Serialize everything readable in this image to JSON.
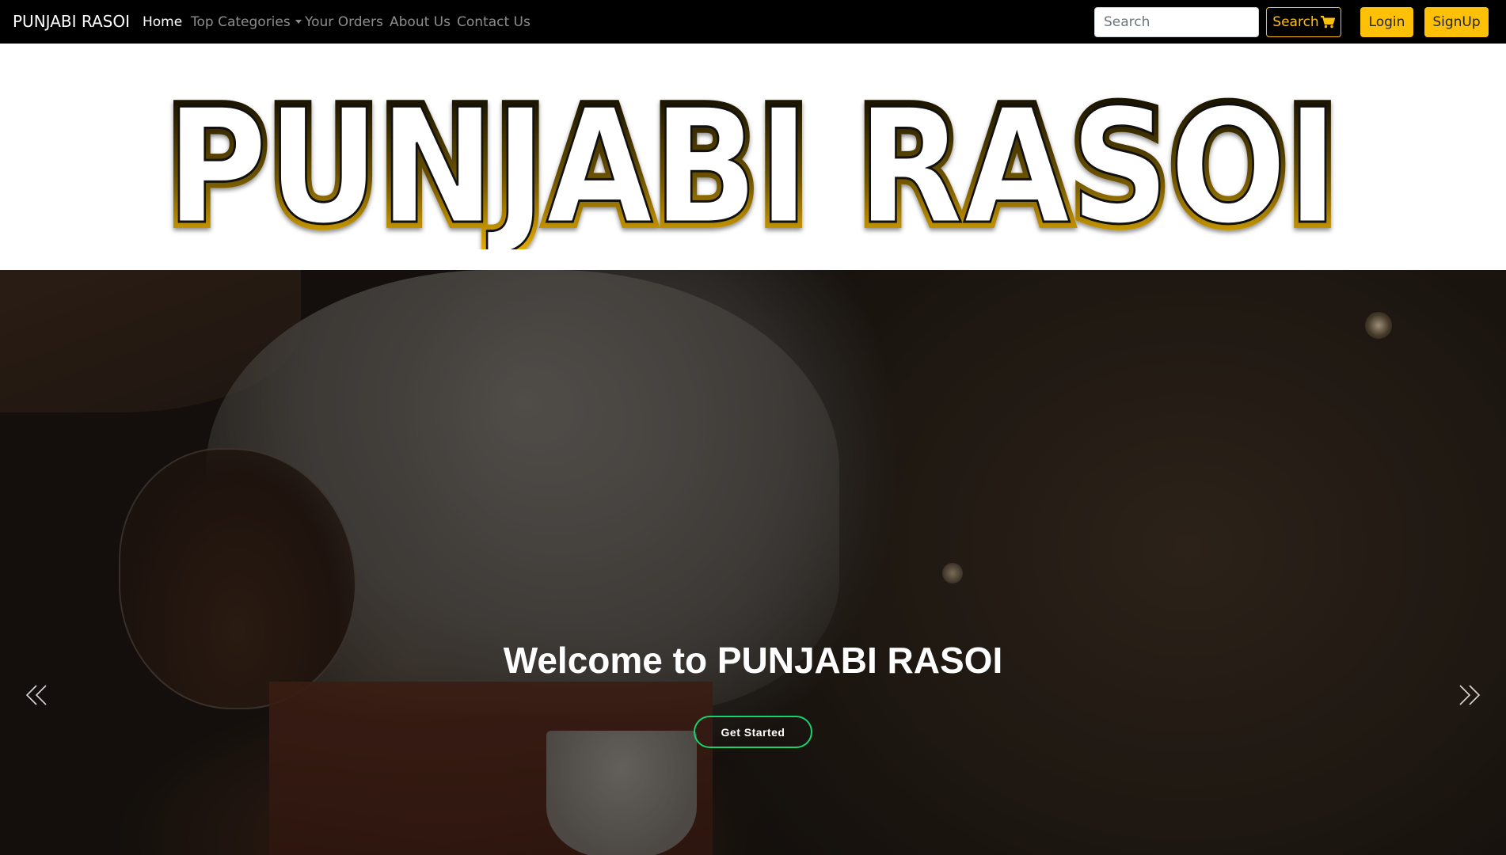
{
  "navbar": {
    "brand": "PUNJABI RASOI",
    "links": [
      {
        "label": "Home",
        "active": true
      },
      {
        "label": "Top Categories",
        "dropdown": true
      },
      {
        "label": "Your Orders"
      },
      {
        "label": "About Us"
      },
      {
        "label": "Contact Us"
      }
    ],
    "search": {
      "placeholder": "Search",
      "value": ""
    },
    "search_button": {
      "label": "Search",
      "icon": "cart-icon"
    },
    "login_button": "Login",
    "signup_button": "SignUp"
  },
  "banner": {
    "logo_text": "PUNJABI RASOI",
    "gradient": [
      "#000000",
      "#f5b800"
    ]
  },
  "hero": {
    "title": "Welcome to PUNJABI RASOI",
    "cta_label": "Get Started",
    "prev_icon": "double-chevron-left-icon",
    "next_icon": "double-chevron-right-icon"
  },
  "colors": {
    "accent": "#ffc107",
    "cta_border": "#18d26e",
    "navbar_bg": "#000000"
  }
}
